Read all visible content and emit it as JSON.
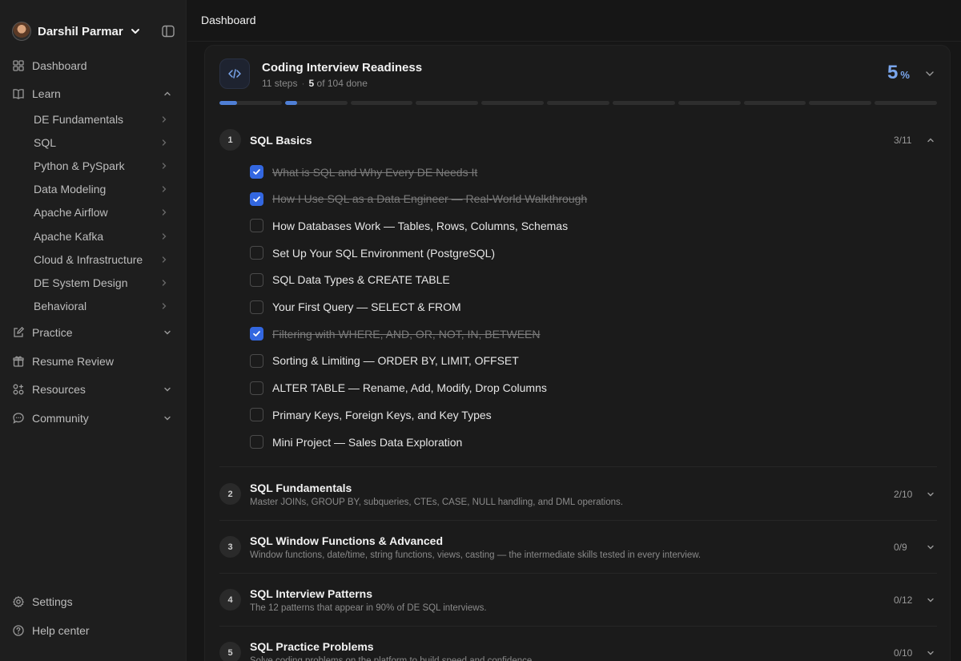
{
  "user": {
    "name": "Darshil Parmar"
  },
  "topbar": {
    "title": "Dashboard"
  },
  "nav": {
    "dashboard": "Dashboard",
    "learn": "Learn",
    "learn_items": [
      "DE Fundamentals",
      "SQL",
      "Python & PySpark",
      "Data Modeling",
      "Apache Airflow",
      "Apache Kafka",
      "Cloud & Infrastructure",
      "DE System Design",
      "Behavioral"
    ],
    "practice": "Practice",
    "resume": "Resume Review",
    "resources": "Resources",
    "community": "Community",
    "settings": "Settings",
    "help": "Help center"
  },
  "course": {
    "title": "Coding Interview Readiness",
    "steps": "11 steps",
    "done_count": "5",
    "done_suffix": "of 104 done",
    "percent": "5",
    "percent_sym": "%",
    "segments": [
      0.28,
      0.2,
      0,
      0,
      0,
      0,
      0,
      0,
      0,
      0,
      0
    ]
  },
  "sections": [
    {
      "num": "1",
      "title": "SQL Basics",
      "count": "3/11",
      "desc": "",
      "lessons": [
        {
          "text": "What is SQL and Why Every DE Needs It",
          "done": true
        },
        {
          "text": "How I Use SQL as a Data Engineer — Real-World Walkthrough",
          "done": true
        },
        {
          "text": "How Databases Work — Tables, Rows, Columns, Schemas",
          "done": false
        },
        {
          "text": "Set Up Your SQL Environment (PostgreSQL)",
          "done": false
        },
        {
          "text": "SQL Data Types & CREATE TABLE",
          "done": false
        },
        {
          "text": "Your First Query — SELECT & FROM",
          "done": false
        },
        {
          "text": "Filtering with WHERE, AND, OR, NOT, IN, BETWEEN",
          "done": true
        },
        {
          "text": "Sorting & Limiting — ORDER BY, LIMIT, OFFSET",
          "done": false
        },
        {
          "text": "ALTER TABLE — Rename, Add, Modify, Drop Columns",
          "done": false
        },
        {
          "text": "Primary Keys, Foreign Keys, and Key Types",
          "done": false
        },
        {
          "text": "Mini Project — Sales Data Exploration",
          "done": false
        }
      ]
    },
    {
      "num": "2",
      "title": "SQL Fundamentals",
      "count": "2/10",
      "desc": "Master JOINs, GROUP BY, subqueries, CTEs, CASE, NULL handling, and DML operations."
    },
    {
      "num": "3",
      "title": "SQL Window Functions & Advanced",
      "count": "0/9",
      "desc": "Window functions, date/time, string functions, views, casting — the intermediate skills tested in every interview."
    },
    {
      "num": "4",
      "title": "SQL Interview Patterns",
      "count": "0/12",
      "desc": "The 12 patterns that appear in 90% of DE SQL interviews."
    },
    {
      "num": "5",
      "title": "SQL Practice Problems",
      "count": "0/10",
      "desc": "Solve coding problems on the platform to build speed and confidence."
    }
  ]
}
